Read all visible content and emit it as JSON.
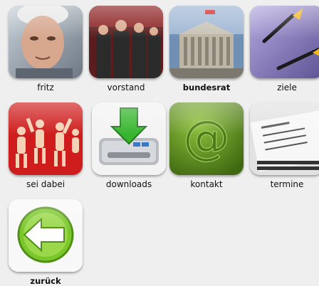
{
  "tiles": [
    {
      "label": "fritz",
      "icon": "portrait-photo"
    },
    {
      "label": "vorstand",
      "icon": "group-photo"
    },
    {
      "label": "bundesrat",
      "icon": "parliament-photo"
    },
    {
      "label": "ziele",
      "icon": "darts-target"
    },
    {
      "label": "sei dabei",
      "icon": "dancing-people"
    },
    {
      "label": "downloads",
      "icon": "download-drive"
    },
    {
      "label": "kontakt",
      "icon": "at-sign"
    },
    {
      "label": "termine",
      "icon": "calendar"
    },
    {
      "label": "zurück",
      "icon": "back-arrow"
    }
  ],
  "colors": {
    "background": "#efefef",
    "sei_dabei_red": "#d11a1a",
    "kontakt_green": "#5f8f1c",
    "zurueck_green": "#7ac72b",
    "downloads_arrow": "#37b52f"
  }
}
